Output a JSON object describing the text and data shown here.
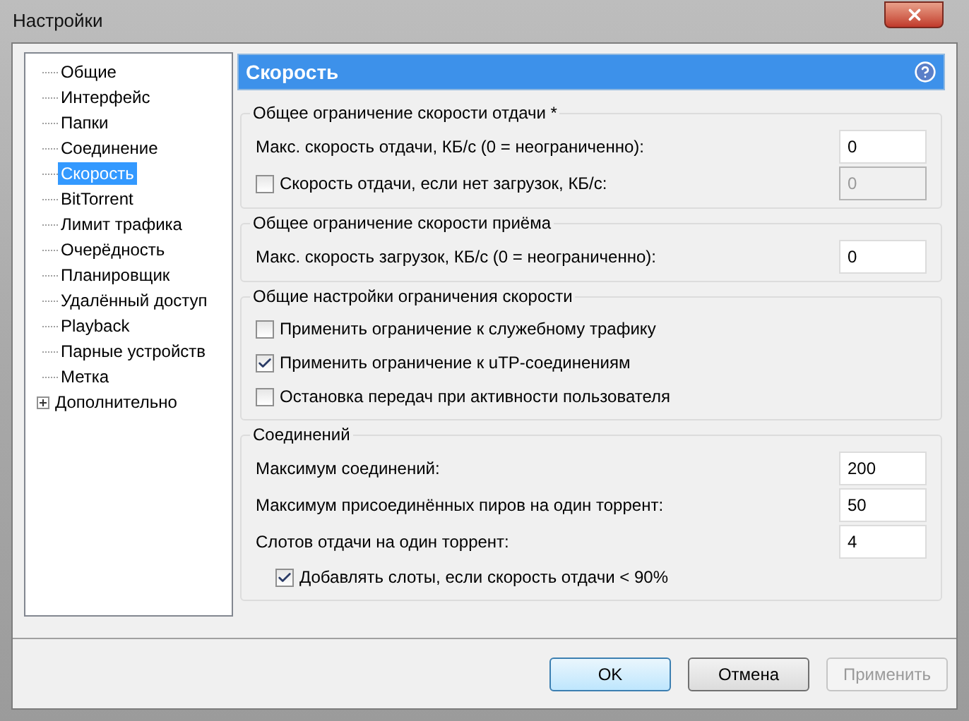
{
  "window": {
    "title": "Настройки"
  },
  "sidebar": {
    "items": [
      {
        "label": "Общие",
        "selected": false
      },
      {
        "label": "Интерфейс",
        "selected": false
      },
      {
        "label": "Папки",
        "selected": false
      },
      {
        "label": "Соединение",
        "selected": false
      },
      {
        "label": "Скорость",
        "selected": true
      },
      {
        "label": "BitTorrent",
        "selected": false
      },
      {
        "label": "Лимит трафика",
        "selected": false
      },
      {
        "label": "Очерёдность",
        "selected": false
      },
      {
        "label": "Планировщик",
        "selected": false
      },
      {
        "label": "Удалённый доступ",
        "selected": false
      },
      {
        "label": "Playback",
        "selected": false
      },
      {
        "label": "Парные устройств",
        "selected": false
      },
      {
        "label": "Метка",
        "selected": false
      },
      {
        "label": "Дополнительно",
        "selected": false,
        "expanded": false
      }
    ]
  },
  "panel": {
    "title": "Скорость",
    "groups": [
      {
        "title": "Общее ограничение скорости отдачи *",
        "rows": [
          {
            "kind": "field",
            "label": "Макс. скорость отдачи, КБ/с (0 = неограниченно):",
            "value": "0",
            "disabled": false
          },
          {
            "kind": "checkbox_field",
            "label": "Скорость отдачи, если нет загрузок, КБ/с:",
            "checked": false,
            "value": "0",
            "disabled": true
          }
        ]
      },
      {
        "title": "Общее ограничение скорости приёма",
        "rows": [
          {
            "kind": "field",
            "label": "Макс. скорость загрузок, КБ/с (0 = неограниченно):",
            "value": "0",
            "disabled": false
          }
        ]
      },
      {
        "title": "Общие настройки ограничения скорости",
        "rows": [
          {
            "kind": "checkbox",
            "label": "Применить ограничение к служебному трафику",
            "checked": false
          },
          {
            "kind": "checkbox",
            "label": "Применить ограничение к uTP-соединениям",
            "checked": true
          },
          {
            "kind": "checkbox",
            "label": "Остановка передач при активности пользователя",
            "checked": false
          }
        ]
      },
      {
        "title": "Соединений",
        "rows": [
          {
            "kind": "field",
            "label": "Максимум соединений:",
            "value": "200",
            "disabled": false
          },
          {
            "kind": "field",
            "label": "Максимум присоединённых пиров на один торрент:",
            "value": "50",
            "disabled": false
          },
          {
            "kind": "field",
            "label": "Слотов отдачи на один торрент:",
            "value": "4",
            "disabled": false
          },
          {
            "kind": "sub_checkbox",
            "label": "Добавлять слоты, если скорость отдачи < 90%",
            "checked": true
          }
        ]
      }
    ]
  },
  "buttons": [
    {
      "label": "OK",
      "default": true,
      "disabled": false
    },
    {
      "label": "Отмена",
      "default": false,
      "disabled": false
    },
    {
      "label": "Применить",
      "default": false,
      "disabled": true
    }
  ]
}
